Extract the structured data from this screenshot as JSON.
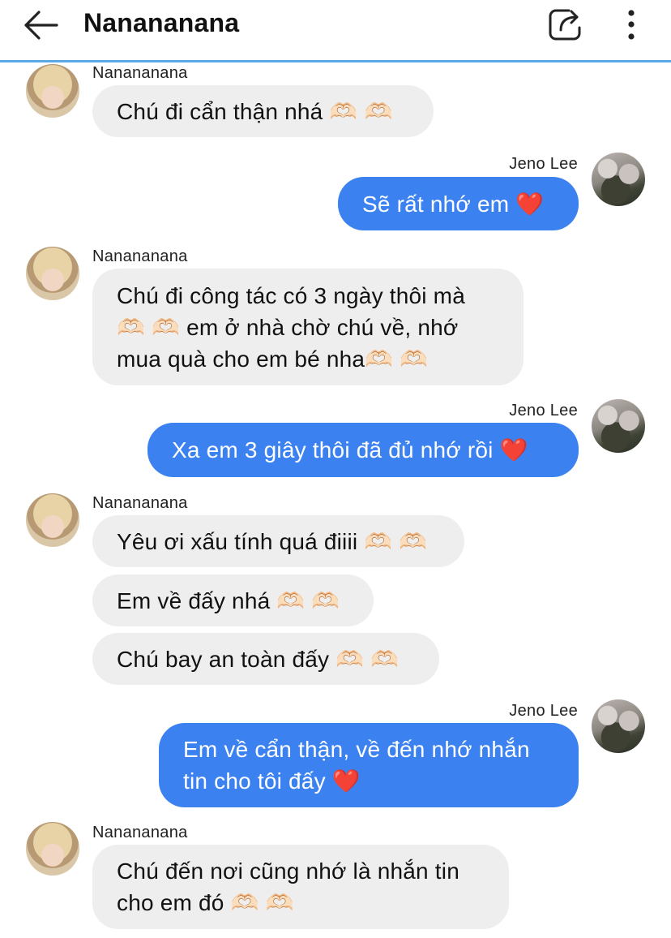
{
  "header": {
    "title": "Nanananana"
  },
  "messages": [
    {
      "sender": "Nanananana",
      "text": "Chú đi cẩn thận nhá 🫶🏻 🫶🏻"
    },
    {
      "sender": "Jeno Lee",
      "text": "Sẽ rất nhớ em ❤️"
    },
    {
      "sender": "Nanananana",
      "text": "Chú đi công tác có 3 ngày thôi mà 🫶🏻 🫶🏻 em ở nhà chờ chú về, nhớ mua quà cho em bé nha🫶🏻 🫶🏻"
    },
    {
      "sender": "Jeno Lee",
      "text": "Xa em 3 giây thôi đã đủ nhớ rồi ❤️"
    },
    {
      "sender": "Nanananana",
      "text": "Yêu ơi xấu tính quá điiii 🫶🏻 🫶🏻"
    },
    {
      "sender": "",
      "text": "Em về đấy nhá 🫶🏻 🫶🏻"
    },
    {
      "sender": "",
      "text": "Chú bay an toàn đấy 🫶🏻 🫶🏻"
    },
    {
      "sender": "Jeno Lee",
      "text": "Em về cẩn thận, về đến nhớ nhắn tin cho tôi đấy ❤️"
    },
    {
      "sender": "Nanananana",
      "text": "Chú đến nơi cũng nhớ là nhắn tin cho em đó 🫶🏻 🫶🏻"
    }
  ]
}
